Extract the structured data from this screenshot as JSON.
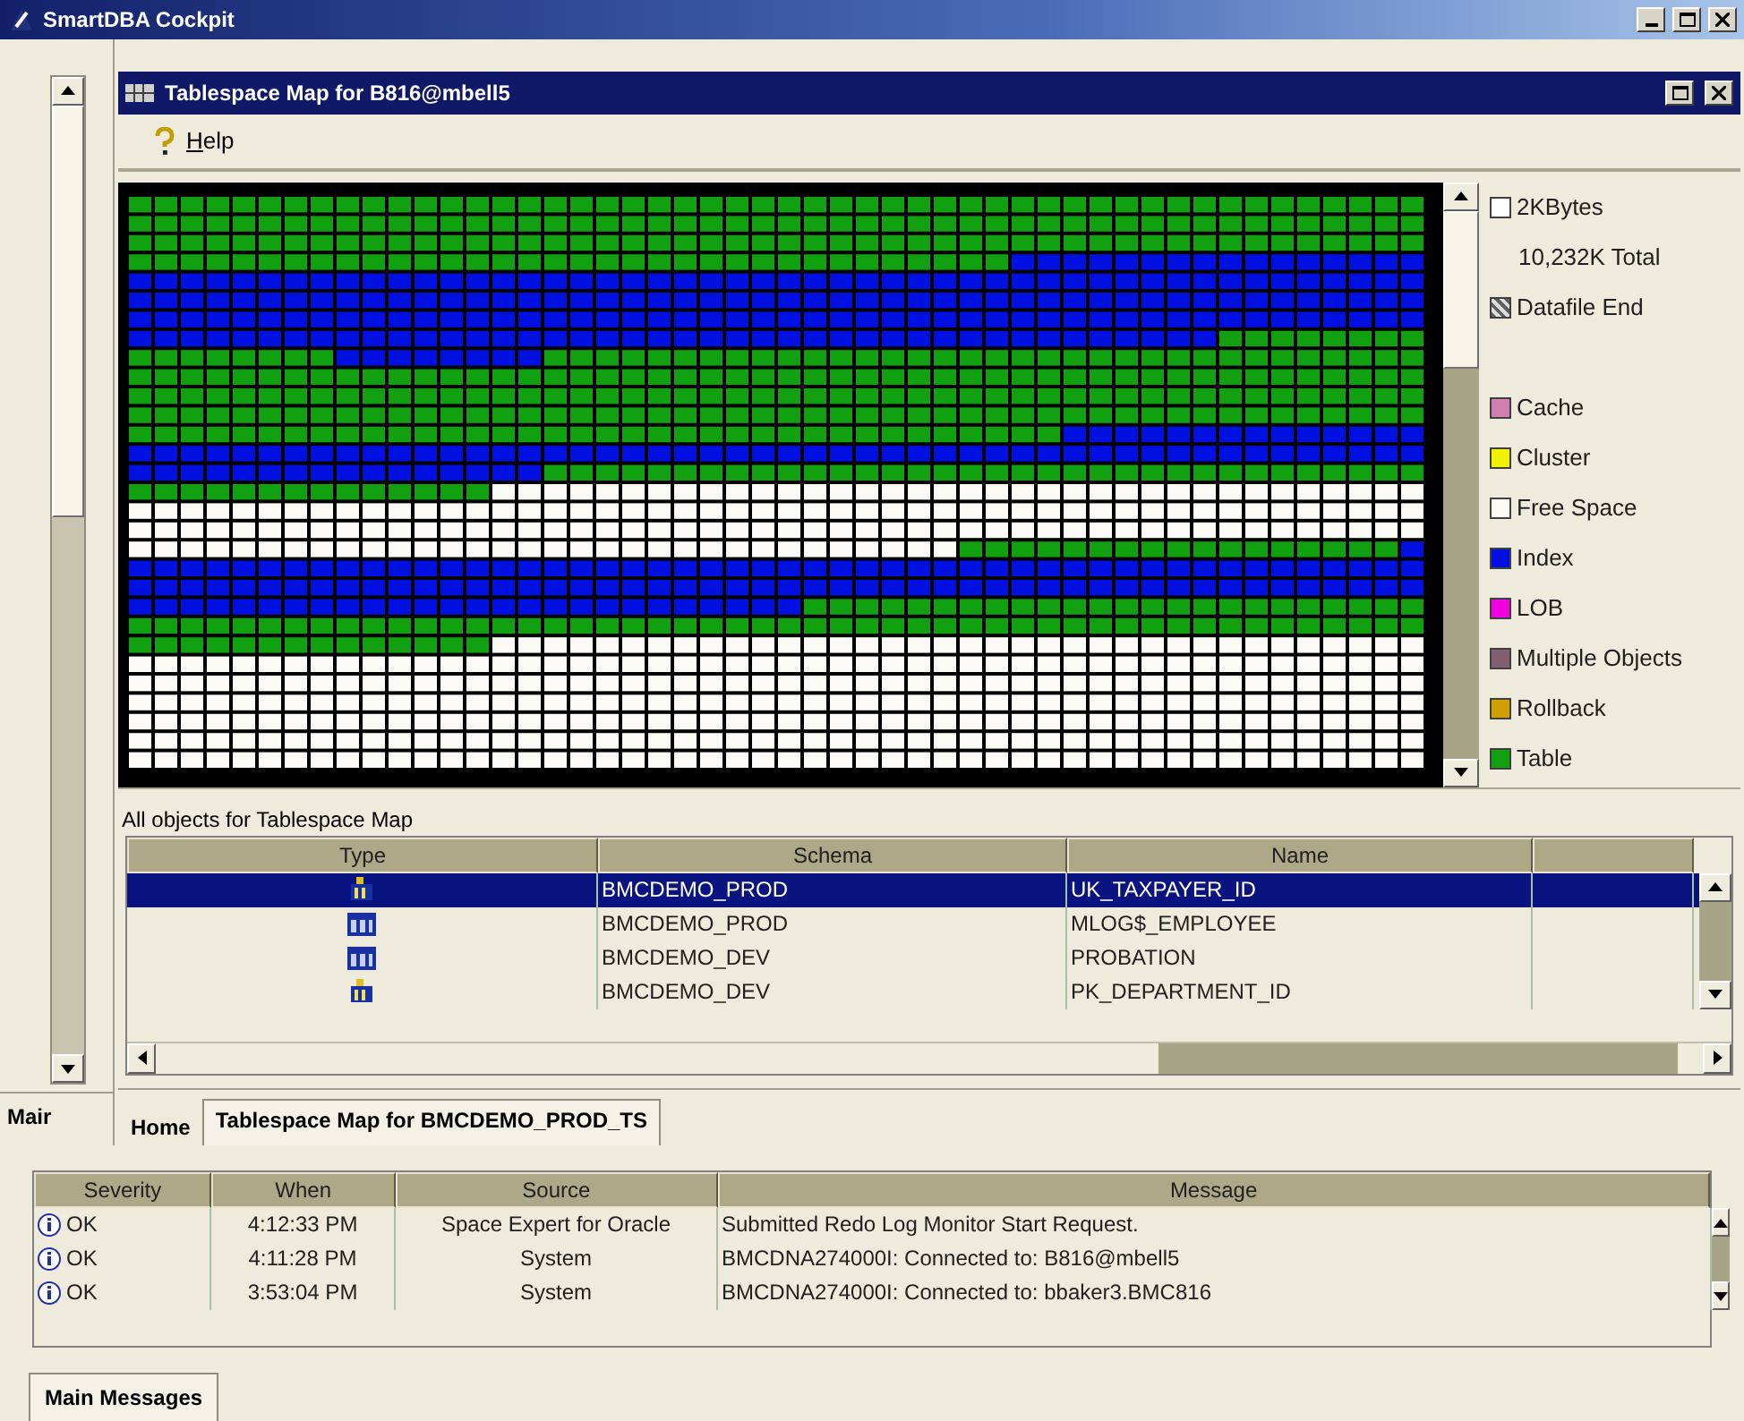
{
  "app_title": "SmartDBA Cockpit",
  "left_panel": {
    "tab": "Mair"
  },
  "window": {
    "title": "Tablespace Map for B816@mbell5"
  },
  "menu": [
    {
      "label": "Help"
    }
  ],
  "legend": [
    {
      "kind": "box",
      "label": "2KBytes"
    },
    {
      "kind": "note",
      "label": "10,232K Total"
    },
    {
      "kind": "hatch",
      "label": "Datafile End"
    },
    {
      "kind": "gap"
    },
    {
      "kind": "swatch",
      "label": "Cache",
      "color": "#d080b0"
    },
    {
      "kind": "swatch",
      "label": "Cluster",
      "color": "#f0f000"
    },
    {
      "kind": "swatch",
      "label": "Free Space",
      "color": "#fbfaf4"
    },
    {
      "kind": "swatch",
      "label": "Index",
      "color": "#0010e0"
    },
    {
      "kind": "swatch",
      "label": "LOB",
      "color": "#f000e0"
    },
    {
      "kind": "swatch",
      "label": "Multiple Objects",
      "color": "#806070"
    },
    {
      "kind": "swatch",
      "label": "Rollback",
      "color": "#d0a000"
    },
    {
      "kind": "swatch",
      "label": "Table",
      "color": "#10a010"
    }
  ],
  "objects_label": "All objects for Tablespace Map",
  "objects_table": {
    "columns": [
      "Type",
      "Schema",
      "Name"
    ],
    "rows": [
      {
        "kind": "index",
        "schema": "BMCDEMO_PROD",
        "name": "UK_TAXPAYER_ID",
        "selected": true
      },
      {
        "kind": "table",
        "schema": "BMCDEMO_PROD",
        "name": "MLOG$_EMPLOYEE",
        "selected": false
      },
      {
        "kind": "table",
        "schema": "BMCDEMO_DEV",
        "name": "PROBATION",
        "selected": false
      },
      {
        "kind": "index",
        "schema": "BMCDEMO_DEV",
        "name": "PK_DEPARTMENT_ID",
        "selected": false
      }
    ]
  },
  "tabs": [
    {
      "label": "Home",
      "selected": false
    },
    {
      "label": "Tablespace Map for BMCDEMO_PROD_TS",
      "selected": true
    }
  ],
  "messages": {
    "columns": [
      "Severity",
      "When",
      "Source",
      "Message"
    ],
    "rows": [
      {
        "severity": "OK",
        "when": "4:12:33 PM",
        "source": "Space Expert for Oracle",
        "message": "Submitted Redo Log Monitor Start Request."
      },
      {
        "severity": "OK",
        "when": "4:11:28 PM",
        "source": "System",
        "message": "BMCDNA274000I: Connected to: B816@mbell5"
      },
      {
        "severity": "OK",
        "when": "3:53:04 PM",
        "source": "System",
        "message": "BMCDNA274000I: Connected to: bbaker3.BMC816"
      }
    ]
  },
  "bottom_tab": {
    "label": "Main Messages"
  }
}
